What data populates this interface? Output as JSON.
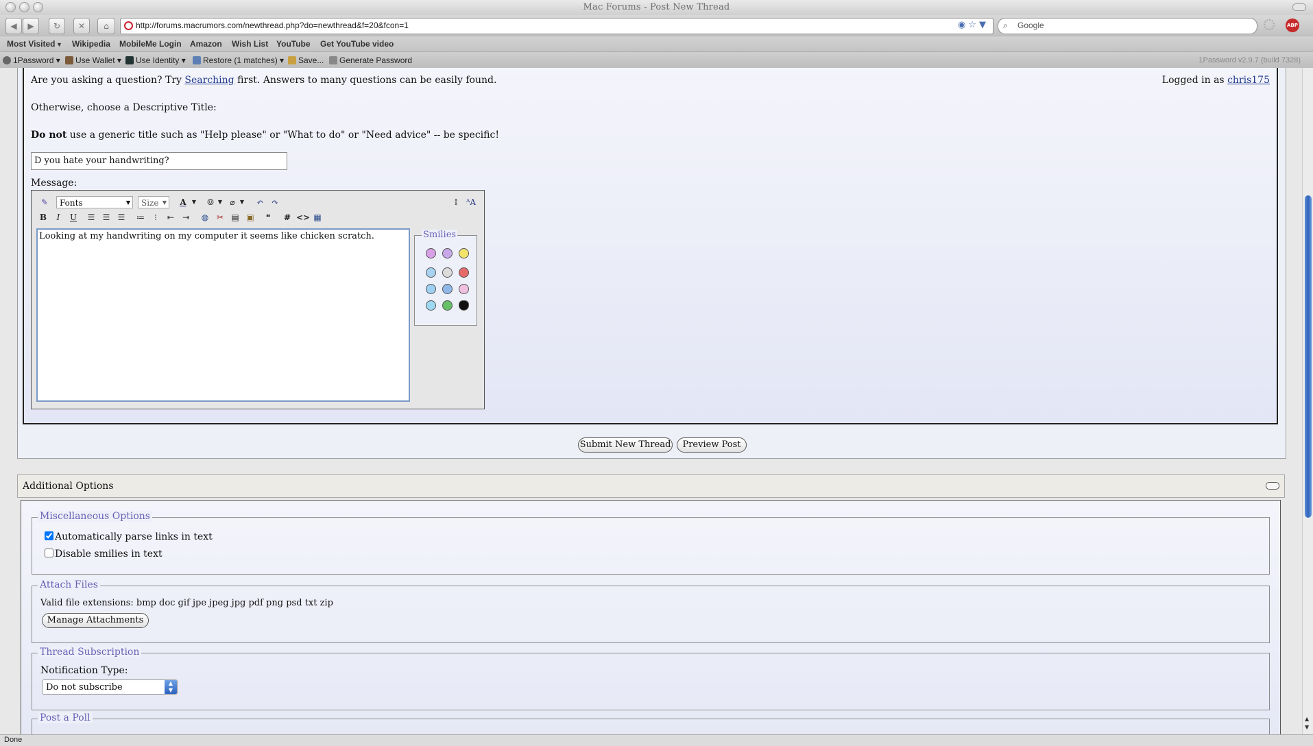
{
  "window": {
    "title": "Mac Forums - Post New Thread"
  },
  "navbar": {
    "url": "http://forums.macrumors.com/newthread.php?do=newthread&f=20&fcon=1",
    "search_placeholder": "Google"
  },
  "bookmarks": [
    "Most Visited",
    "Wikipedia",
    "MobileMe Login",
    "Amazon",
    "Wish List",
    "YouTube",
    "Get YouTube video"
  ],
  "extension_bar": {
    "items": [
      "1Password",
      "Use Wallet",
      "Use Identity",
      "Restore (1 matches)",
      "Save...",
      "Generate Password"
    ],
    "version": "1Password v2.9.7 (build 7328)"
  },
  "post": {
    "intro_prefix": "Are you asking a question? Try ",
    "intro_link": "Searching",
    "intro_suffix": " first. Answers to many questions can be easily found.",
    "logged_in_prefix": "Logged in as ",
    "username": "chris175",
    "choose_title": "Otherwise, choose a Descriptive Title:",
    "warning_bold": "Do not",
    "warning_rest": " use a generic title such as \"Help please\" or \"What to do\" or \"Need advice\" -- be specific!",
    "title_value": "D you hate your handwriting?",
    "message_label": "Message:",
    "fonts_label": "Fonts",
    "size_label": "Size",
    "message_text": "Looking at my handwriting on my computer it seems like chicken scratch.",
    "smilies_legend": "Smilies"
  },
  "buttons": {
    "submit": "Submit New Thread",
    "preview": "Preview Post",
    "manage": "Manage Attachments"
  },
  "additional": {
    "title": "Additional Options",
    "misc_legend": "Miscellaneous Options",
    "opt_parse_links": "Automatically parse links in text",
    "opt_parse_checked": true,
    "opt_disable_smilies": "Disable smilies in text",
    "opt_disable_checked": false,
    "attach_legend": "Attach Files",
    "valid_ext": "Valid file extensions: bmp doc gif jpe jpeg jpg pdf png psd txt zip",
    "subscription_legend": "Thread Subscription",
    "notification_label": "Notification Type:",
    "notification_value": "Do not subscribe",
    "poll_legend": "Post a Poll"
  },
  "status": {
    "text": "Done"
  }
}
